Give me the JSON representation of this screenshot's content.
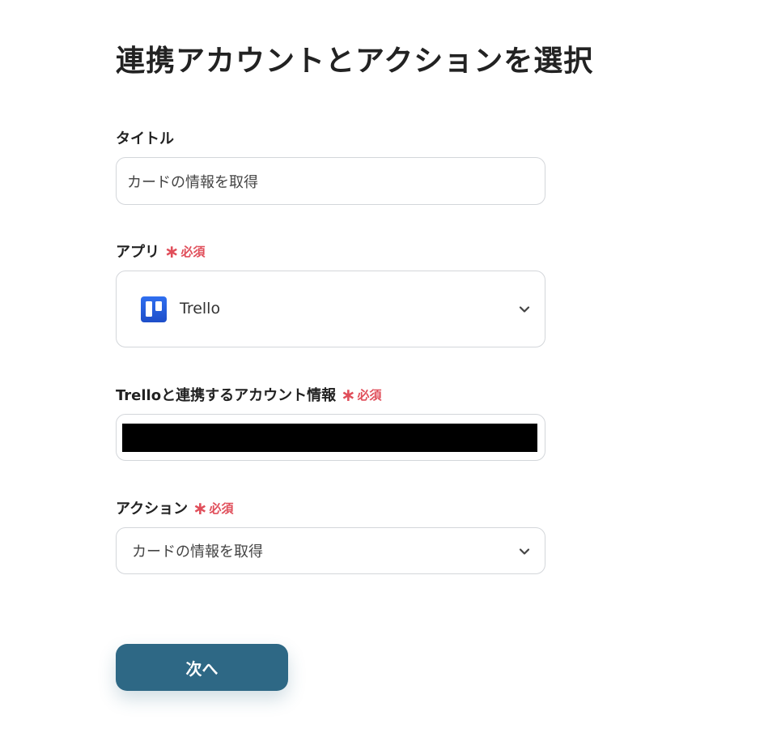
{
  "page": {
    "title": "連携アカウントとアクションを選択"
  },
  "required_star": "∗",
  "fields": {
    "title": {
      "label": "タイトル",
      "value": "カードの情報を取得"
    },
    "app": {
      "label": "アプリ",
      "required_label": "必須",
      "selected": "Trello",
      "icon": "trello-logo"
    },
    "account": {
      "label": "Trelloと連携するアカウント情報",
      "required_label": "必須",
      "value_redacted": true
    },
    "action": {
      "label": "アクション",
      "required_label": "必須",
      "selected": "カードの情報を取得"
    }
  },
  "next_button": {
    "label": "次へ"
  },
  "colors": {
    "primary": "#2e6885",
    "required": "#e04e5a",
    "border": "#d3d6da",
    "trello": "#1e4fc9"
  }
}
